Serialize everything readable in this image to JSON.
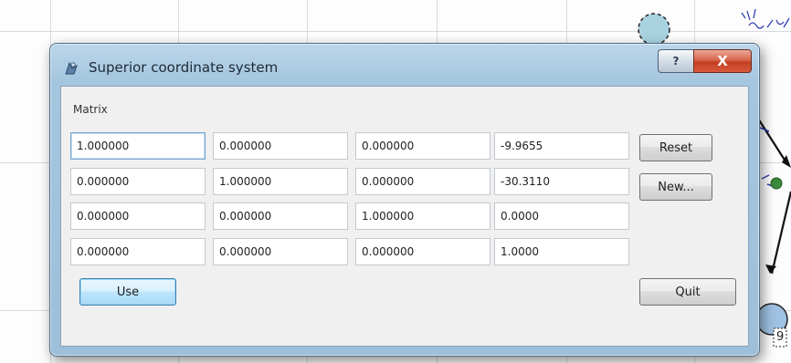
{
  "window": {
    "title": "Superior coordinate system",
    "help_glyph": "?",
    "close_glyph": "X"
  },
  "dialog": {
    "matrix_label": "Matrix",
    "matrix": [
      [
        "1.000000",
        "0.000000",
        "0.000000",
        "-9.9655"
      ],
      [
        "0.000000",
        "1.000000",
        "0.000000",
        "-30.3110"
      ],
      [
        "0.000000",
        "0.000000",
        "1.000000",
        "0.0000"
      ],
      [
        "0.000000",
        "0.000000",
        "0.000000",
        "1.0000"
      ]
    ],
    "buttons": {
      "reset": "Reset",
      "new": "New...",
      "use": "Use",
      "quit": "Quit"
    }
  },
  "background_canvas": {
    "label": "9"
  },
  "colors": {
    "frame": "#9dbfd9",
    "close_button": "#c43f22",
    "default_button": "#bee6fd",
    "client_bg": "#f0f0f0"
  },
  "icons": [
    "app-icon",
    "help-icon",
    "close-icon"
  ]
}
